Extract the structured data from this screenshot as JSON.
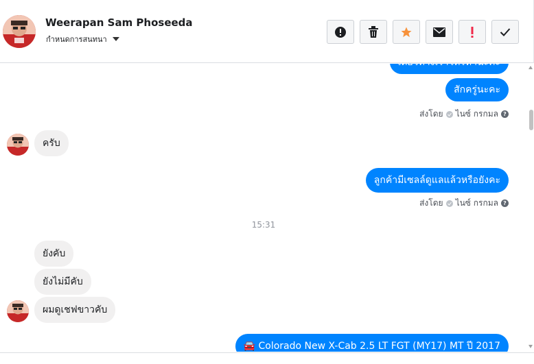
{
  "header": {
    "contact_name": "Weerapan Sam Phoseeda",
    "subtitle": "กำหนดการสนทนา",
    "actions": [
      {
        "name": "report-button",
        "icon": "alert-circle-icon"
      },
      {
        "name": "delete-button",
        "icon": "trash-icon"
      },
      {
        "name": "star-button",
        "icon": "star-icon"
      },
      {
        "name": "mark-unread-button",
        "icon": "envelope-icon"
      },
      {
        "name": "important-button",
        "icon": "exclamation-icon"
      },
      {
        "name": "done-button",
        "icon": "checkmark-icon"
      }
    ]
  },
  "messages": {
    "m0_text": "เดี๋ยวทางเราโทรหานะคะ",
    "m1_text": "สักครู่นะคะ",
    "m1_status_prefix": "ส่งโดย",
    "m1_status_sender": "ไนซ์ กรกมล",
    "m2_text": "ครับ",
    "m3_text": "ลูกค้ามีเซลล์ดูแลแล้วหรือยังคะ",
    "m3_status_prefix": "ส่งโดย",
    "m3_status_sender": "ไนซ์ กรกมล",
    "time_separator": "15:31",
    "m4_text": "ยังคับ",
    "m5_text": "ยังไม่มีคับ",
    "m6_text": "ผมดูเชฟขาวคับ",
    "m7_text": "🚘 Colorado New X-Cab 2.5 LT FGT (MY17) MT ปี 2017"
  },
  "colors": {
    "outgoing_bubble": "#0084ff",
    "incoming_bubble": "#f1f0f0",
    "star": "#f7923b",
    "important": "#f02849"
  }
}
